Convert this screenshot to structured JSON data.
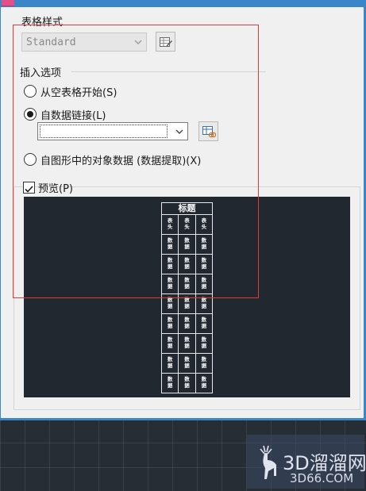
{
  "dialog": {
    "table_style_label": "表格样式",
    "table_style_value": "Standard",
    "insert_options_label": "插入选项",
    "options": [
      {
        "label": "从空表格开始(S)",
        "selected": false
      },
      {
        "label": "自数据链接(L)",
        "selected": true
      },
      {
        "label": "自图形中的对象数据 (数据提取)(X)",
        "selected": false
      }
    ],
    "data_link_value": "",
    "preview_label": "预览(P)",
    "preview_checked": true
  },
  "preview_table": {
    "title": "标题",
    "header": [
      "表头",
      "表头",
      "表头"
    ],
    "data_cell": "数据",
    "data_rows": 8
  },
  "watermark": {
    "logo_text": "3D溜溜网",
    "url": "3D66.COM"
  },
  "colors": {
    "dialog_bg": "#f0f0f0",
    "window_border": "#3a86c8",
    "workspace_bg": "#262d35",
    "preview_bg": "#212830",
    "annotation": "#e23a3a"
  }
}
